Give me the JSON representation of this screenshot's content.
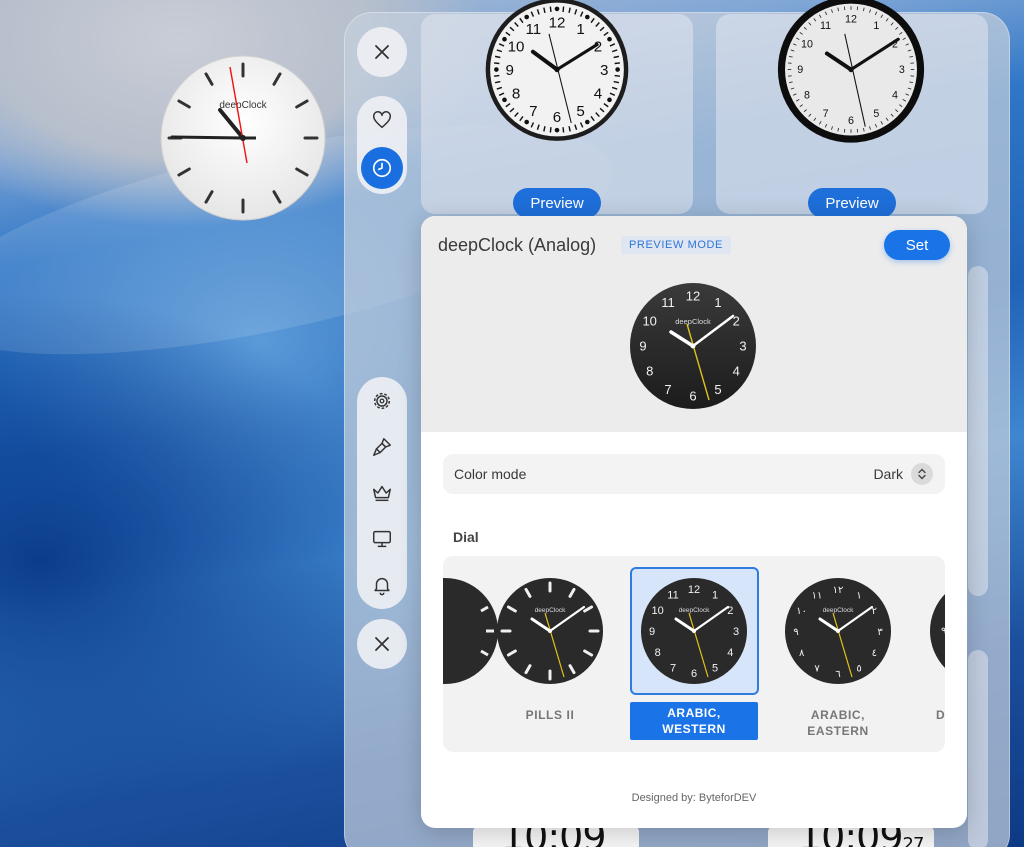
{
  "desktop": {
    "widget_brand": "deepClock"
  },
  "toolbar": {
    "close_top": "close-icon",
    "favorites": "heart-icon",
    "clocks": "clock-icon",
    "tools": [
      "gear-icon",
      "brush-icon",
      "crown-icon",
      "monitor-icon",
      "bell-icon"
    ],
    "close_bottom": "close-icon"
  },
  "gallery": {
    "preview_label_1": "Preview",
    "preview_label_2": "Preview",
    "digital_1": "10:09",
    "digital_2": "10:09",
    "digital_2_seconds": "27"
  },
  "sheet": {
    "title": "deepClock (Analog)",
    "mode_badge": "PREVIEW MODE",
    "set_label": "Set",
    "clock_brand": "deepClock",
    "color_mode_label": "Color mode",
    "color_mode_value": "Dark",
    "dial_section_label": "Dial",
    "dials": [
      {
        "name_line1": "PILLS II",
        "name_line2": ""
      },
      {
        "name_line1": "ARABIC,",
        "name_line2": "WESTERN"
      },
      {
        "name_line1": "ARABIC,",
        "name_line2": "EASTERN"
      },
      {
        "name_line1": "D",
        "name_line2": ""
      }
    ],
    "footer": "Designed by: ByteforDEV"
  },
  "colors": {
    "accent": "#1a74e8",
    "dial_dark": "#2a2a2a",
    "second_hand": "#e1c21a"
  }
}
